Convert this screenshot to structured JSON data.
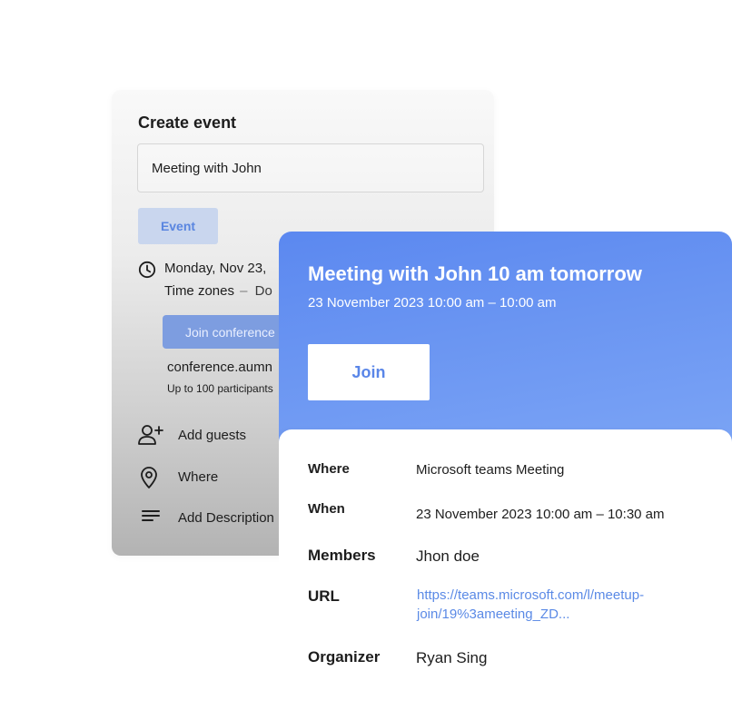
{
  "create_event": {
    "title": "Create event",
    "title_input_value": "Meeting with John",
    "event_chip": "Event",
    "date_text": "Monday, Nov 23,",
    "time_zones_label": "Time zones",
    "time_zones_dash": "–",
    "time_zones_value": "Do",
    "join_conference": "Join conference",
    "conference_link": "conference.aumn",
    "participants": "Up to 100 participants",
    "add_guests": "Add guests",
    "where": "Where",
    "add_description": "Add Description"
  },
  "meeting": {
    "title": "Meeting with John 10 am tomorrow",
    "time": "23 November 2023 10:00 am – 10:00 am",
    "join_label": "Join",
    "accent_color": "#5b88f0",
    "details": {
      "where_label": "Where",
      "where_value": "Microsoft teams Meeting",
      "when_label": "When",
      "when_value": "23 November 2023 10:00 am – 10:30 am",
      "members_label": "Members",
      "members_value": "Jhon doe",
      "url_label": "URL",
      "url_line1": "https://teams.microsoft.com/l/meetup-",
      "url_line2": "join/19%3ameeting_ZD...",
      "organizer_label": "Organizer",
      "organizer_value": "Ryan Sing"
    }
  },
  "icons": {
    "clock": "clock-icon",
    "add_user": "add-user-icon",
    "location": "location-pin-icon",
    "description": "text-lines-icon"
  }
}
